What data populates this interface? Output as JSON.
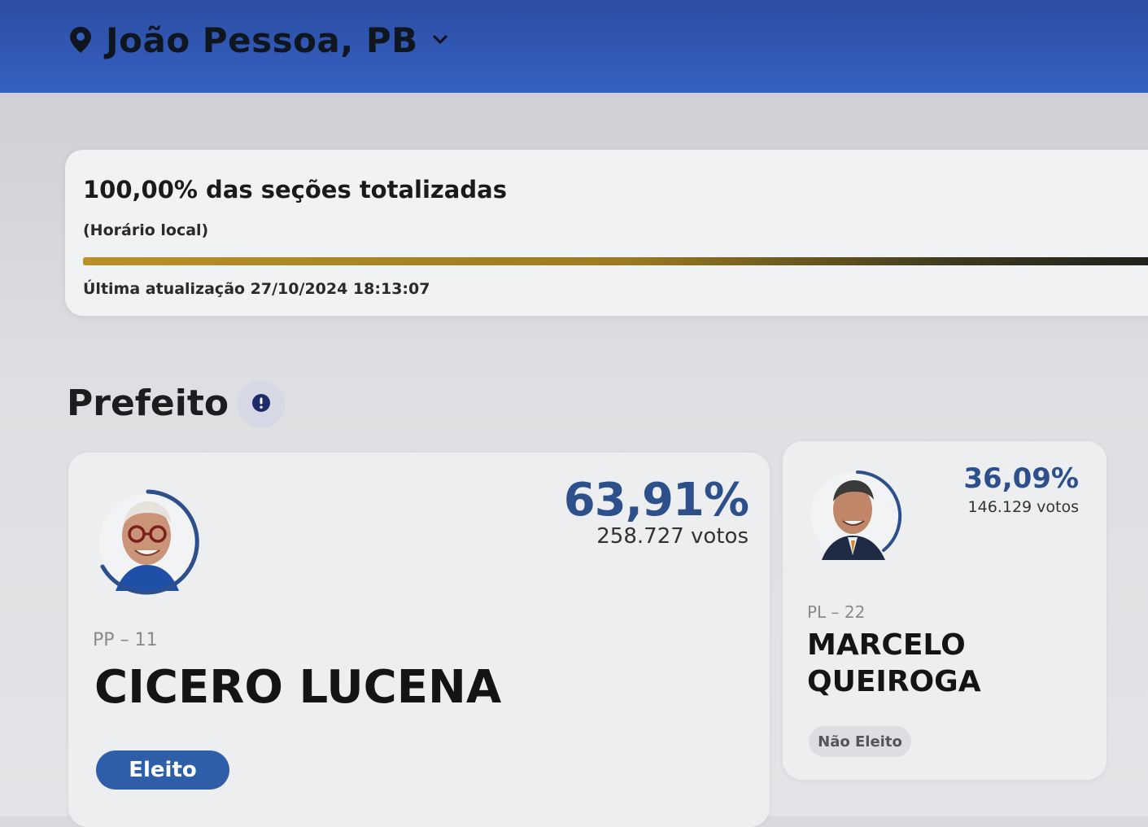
{
  "header": {
    "location": "João Pessoa, PB",
    "colors": {
      "background": "#3560c2",
      "text": "#0f1620"
    }
  },
  "status": {
    "title": "100,00% das seções totalizadas",
    "subtitle": "(Horário local)",
    "progress_percent": 100,
    "last_update": "Última atualização 27/10/2024 18:13:07"
  },
  "section": {
    "title": "Prefeito",
    "info_icon": "info-icon"
  },
  "candidates": [
    {
      "percent": "63,91%",
      "votes": "258.727 votos",
      "party": "PP – 11",
      "name": "CICERO LUCENA",
      "status": "Eleito",
      "vote_share": 0.6391,
      "photo_icon": "candidate-photo"
    },
    {
      "percent": "36,09%",
      "votes": "146.129 votos",
      "party": "PL – 22",
      "name": "MARCELO QUEIROGA",
      "status": "Não Eleito",
      "vote_share": 0.3609,
      "photo_icon": "candidate-photo"
    }
  ],
  "colors": {
    "accent": "#2d4f8c",
    "elected_badge": "#2f5ea8",
    "progress": "#b8912a"
  }
}
